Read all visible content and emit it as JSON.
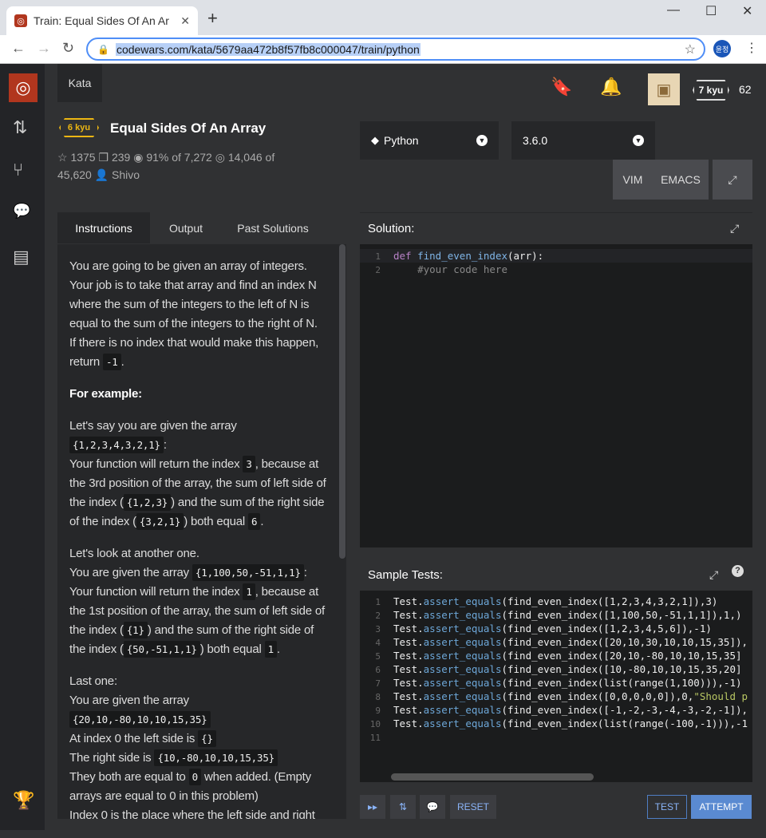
{
  "browser": {
    "tab_title": "Train: Equal Sides Of An Ar",
    "url": "codewars.com/kata/5679aa472b8f57fb8c000047/train/python",
    "profile": "윤정"
  },
  "header": {
    "kata_tab": "Kata",
    "rank": "7 kyu",
    "honor": "62"
  },
  "kata": {
    "rank": "6 kyu",
    "title": "Equal Sides Of An Array",
    "stars": "1375",
    "collections": "239",
    "satisfaction": "91% of 7,272",
    "completed": "14,046 of",
    "attempts": "45,620",
    "author": "Shivo"
  },
  "language": {
    "name": "Python",
    "version": "3.6.0",
    "mode_vim": "VIM",
    "mode_emacs": "EMACS"
  },
  "left_tabs": {
    "instructions": "Instructions",
    "output": "Output",
    "past": "Past Solutions"
  },
  "instructions": {
    "p1": "You are going to be given an array of integers. Your job is to take that array and find an index N where the sum of the integers to the left of N is equal to the sum of the integers to the right of N. If there is no index that would make this happen, return",
    "p1_code": "-1",
    "example_heading": "For example:",
    "e1a": "Let's say you are given the array",
    "e1_arr": "{1,2,3,4,3,2,1}",
    "e1b": "Your function will return the index",
    "e1_idx": "3",
    "e1c": ", because at the 3rd position of the array, the sum of left side of the index (",
    "e1_left": "{1,2,3}",
    "e1d": ") and the sum of the right side of the index (",
    "e1_right": "{3,2,1}",
    "e1e": ") both equal",
    "e1_sum": "6",
    "e2a": "Let's look at another one.",
    "e2b": "You are given the array",
    "e2_arr": "{1,100,50,-51,1,1}",
    "e2c": "Your function will return the index",
    "e2_idx": "1",
    "e2d": ", because at the 1st position of the array, the sum of left side of the index (",
    "e2_left": "{1}",
    "e2e": ") and the sum of the right side of the index (",
    "e2_right": "{50,-51,1,1}",
    "e2f": ") both equal",
    "e2_sum": "1",
    "e3a": "Last one:",
    "e3b": "You are given the array",
    "e3_arr": "{20,10,-80,10,10,15,35}",
    "e3c": "At index 0 the left side is",
    "e3_left": "{}",
    "e3d": "The right side is",
    "e3_right": "{10,-80,10,10,15,35}",
    "e3e": "They both are equal to",
    "e3_zero": "0",
    "e3f": "when added. (Empty arrays are equal to 0 in this problem)",
    "e3g": "Index 0 is the place where the left side and right"
  },
  "solution": {
    "header": "Solution:",
    "lines": [
      {
        "num": "1",
        "kw": "def",
        "fn": "find_even_index",
        "rest": "(arr):"
      },
      {
        "num": "2",
        "comment": "    #your code here"
      }
    ]
  },
  "tests": {
    "header": "Sample Tests:",
    "lines": [
      {
        "num": "1",
        "obj": "Test",
        "method": "assert_equals",
        "args": "(find_even_index([1,2,3,4,3,2,1]),3)"
      },
      {
        "num": "2",
        "obj": "Test",
        "method": "assert_equals",
        "args": "(find_even_index([1,100,50,-51,1,1]),1,)"
      },
      {
        "num": "3",
        "obj": "Test",
        "method": "assert_equals",
        "args": "(find_even_index([1,2,3,4,5,6]),-1)"
      },
      {
        "num": "4",
        "obj": "Test",
        "method": "assert_equals",
        "args": "(find_even_index([20,10,30,10,10,15,35]),"
      },
      {
        "num": "5",
        "obj": "Test",
        "method": "assert_equals",
        "args": "(find_even_index([20,10,-80,10,10,15,35]"
      },
      {
        "num": "6",
        "obj": "Test",
        "method": "assert_equals",
        "args": "(find_even_index([10,-80,10,10,15,35,20]"
      },
      {
        "num": "7",
        "obj": "Test",
        "method": "assert_equals",
        "args": "(find_even_index(list(range(1,100))),-1)"
      },
      {
        "num": "8",
        "obj": "Test",
        "method": "assert_equals",
        "args": "(find_even_index([0,0,0,0,0]),0,",
        "str": "\"Should p"
      },
      {
        "num": "9",
        "obj": "Test",
        "method": "assert_equals",
        "args": "(find_even_index([-1,-2,-3,-4,-3,-2,-1]),"
      },
      {
        "num": "10",
        "obj": "Test",
        "method": "assert_equals",
        "args": "(find_even_index(list(range(-100,-1))),-1"
      },
      {
        "num": "11"
      }
    ]
  },
  "actions": {
    "reset": "RESET",
    "test": "TEST",
    "attempt": "ATTEMPT"
  }
}
